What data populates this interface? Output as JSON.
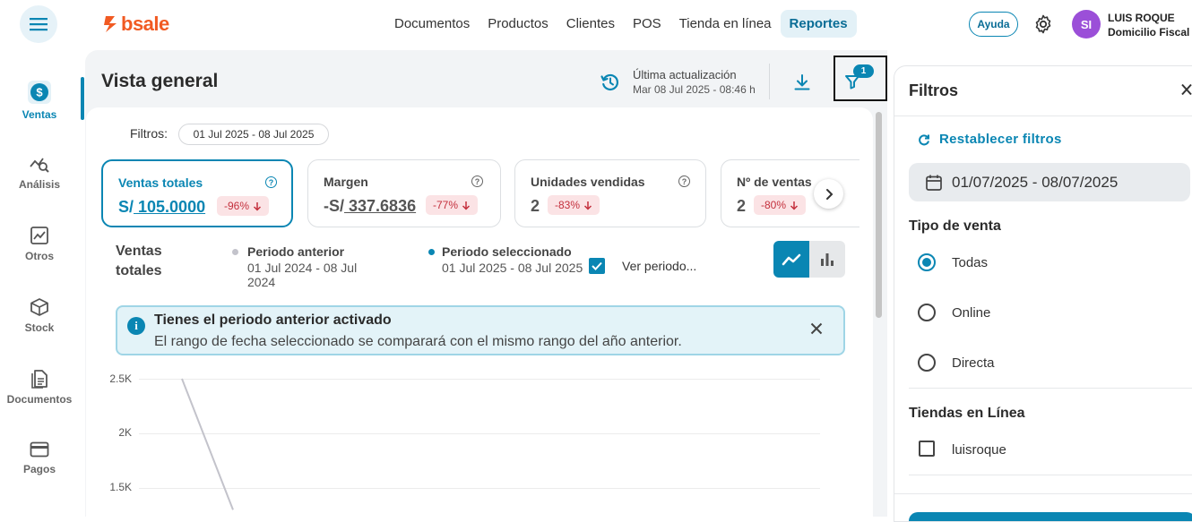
{
  "brand": {
    "logo_text": "bsale",
    "color": "#f15a22"
  },
  "nav": [
    {
      "label": "Documentos",
      "active": false
    },
    {
      "label": "Productos",
      "active": false
    },
    {
      "label": "Clientes",
      "active": false
    },
    {
      "label": "POS",
      "active": false
    },
    {
      "label": "Tienda en línea",
      "active": false
    },
    {
      "label": "Reportes",
      "active": true
    }
  ],
  "header": {
    "help_label": "Ayuda",
    "avatar_initials": "SI",
    "user_name": "LUIS ROQUE",
    "user_company": "Domicilio Fiscal"
  },
  "sidebar": [
    {
      "label": "Ventas",
      "icon": "dollar-icon",
      "active": true
    },
    {
      "label": "Análisis",
      "icon": "analysis-icon",
      "active": false
    },
    {
      "label": "Otros",
      "icon": "chart-up-icon",
      "active": false
    },
    {
      "label": "Stock",
      "icon": "box-icon",
      "active": false
    },
    {
      "label": "Documentos",
      "icon": "document-icon",
      "active": false
    },
    {
      "label": "Pagos",
      "icon": "card-icon",
      "active": false
    }
  ],
  "main": {
    "title": "Vista general",
    "last_update_label": "Última actualización",
    "last_update_date": "Mar 08 Jul 2025 - 08:46 h",
    "filter_badge": "1",
    "filters_label": "Filtros:",
    "filters_chip": "01 Jul 2025 - 08 Jul 2025"
  },
  "kpis": [
    {
      "title": "Ventas totales",
      "prefix": "S/",
      "value": " 105.0000",
      "pct": "-96%",
      "selected": true
    },
    {
      "title": "Margen",
      "prefix": "-S/",
      "value": " 337.6836",
      "pct": "-77%",
      "selected": false
    },
    {
      "title": "Unidades vendidas",
      "prefix": "",
      "value": "2",
      "pct": "-83%",
      "selected": false
    },
    {
      "title": "Nº de ventas",
      "prefix": "",
      "value": "2",
      "pct": "-80%",
      "selected": false
    }
  ],
  "chart_section": {
    "title_line1": "Ventas",
    "title_line2": "totales",
    "prev_title": "Periodo anterior",
    "prev_range": "01 Jul 2024 - 08 Jul 2024",
    "sel_title": "Periodo seleccionado",
    "sel_range": "01 Jul 2025 - 08 Jul 2025",
    "compare_label": "Ver periodo...",
    "compare_checked": true,
    "prev_color": "#c3c3cb",
    "sel_color": "#0a86b3"
  },
  "alert": {
    "title": "Tienes el periodo anterior activado",
    "message": "El rango de fecha seleccionado se comparará con el mismo rango del año anterior."
  },
  "chart_data": {
    "type": "line",
    "yticks": [
      "2.5K",
      "2K",
      "1.5K"
    ],
    "ylim_visible": [
      1500,
      2500
    ],
    "series": [
      {
        "name": "Periodo anterior",
        "values": [
          2500,
          1300
        ]
      }
    ]
  },
  "filters_panel": {
    "title": "Filtros",
    "reset_label": "Restablecer filtros",
    "date_range": "01/07/2025 - 08/07/2025",
    "sale_type_title": "Tipo de venta",
    "sale_types": [
      {
        "label": "Todas",
        "selected": true
      },
      {
        "label": "Online",
        "selected": false
      },
      {
        "label": "Directa",
        "selected": false
      }
    ],
    "online_stores_title": "Tiendas en Línea",
    "online_stores": [
      {
        "label": "luisroque",
        "checked": false
      }
    ]
  }
}
